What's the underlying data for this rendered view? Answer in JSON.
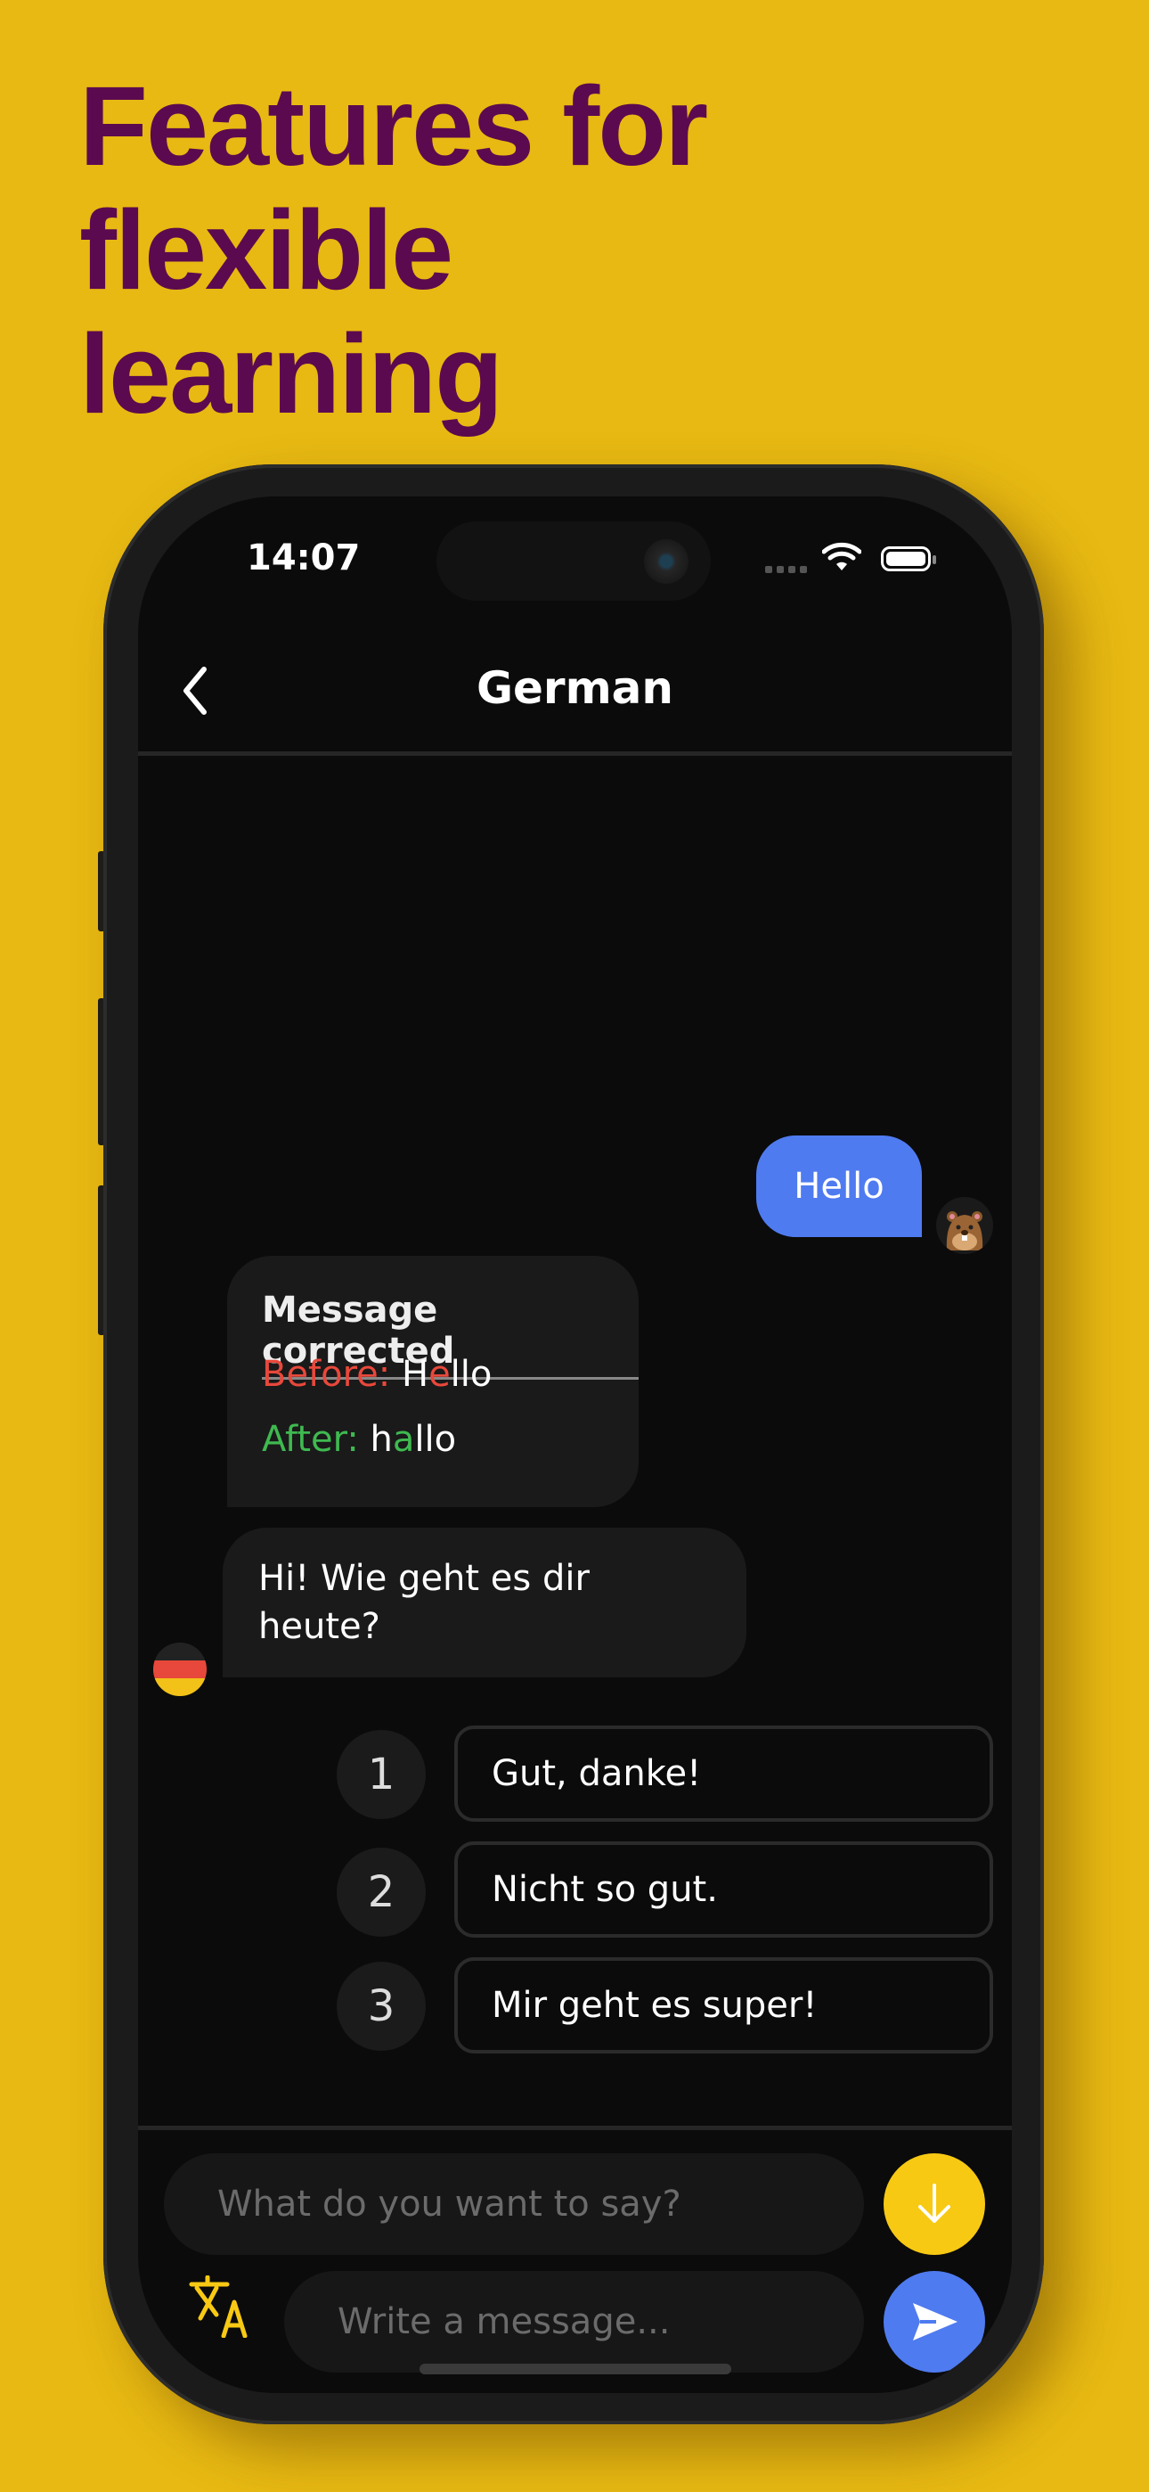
{
  "headline": {
    "lines": [
      "Features for",
      "flexible",
      "learning"
    ]
  },
  "colors": {
    "background": "#E8B912",
    "headline": "#5C0A4F",
    "user_bubble": "#4F7BF0",
    "accent_yellow": "#F8C913",
    "error_red": "#E8483B",
    "success_green": "#3FB950"
  },
  "status_bar": {
    "time": "14:07",
    "icons": [
      "signal-icon",
      "wifi-icon",
      "battery-icon"
    ]
  },
  "nav": {
    "back_icon": "chevron-left-icon",
    "title": "German"
  },
  "messages": {
    "user": {
      "text": "Hello",
      "avatar": "beaver-avatar"
    },
    "correction": {
      "heading": "Message corrected",
      "before_label": "Before:",
      "before_parts": [
        "H",
        "e",
        "llo"
      ],
      "after_label": "After:",
      "after_parts": [
        "h",
        "a",
        "llo"
      ]
    },
    "bot": {
      "text": "Hi! Wie geht es dir heute?",
      "avatar": "german-flag-avatar"
    }
  },
  "options": [
    {
      "number": "1",
      "text": "Gut, danke!"
    },
    {
      "number": "2",
      "text": "Nicht so gut."
    },
    {
      "number": "3",
      "text": "Mir geht es super!"
    }
  ],
  "composer": {
    "suggest_placeholder": "What do you want to say?",
    "message_placeholder": "Write a message...",
    "icons": [
      "arrow-down-icon",
      "translate-icon",
      "send-icon"
    ]
  }
}
